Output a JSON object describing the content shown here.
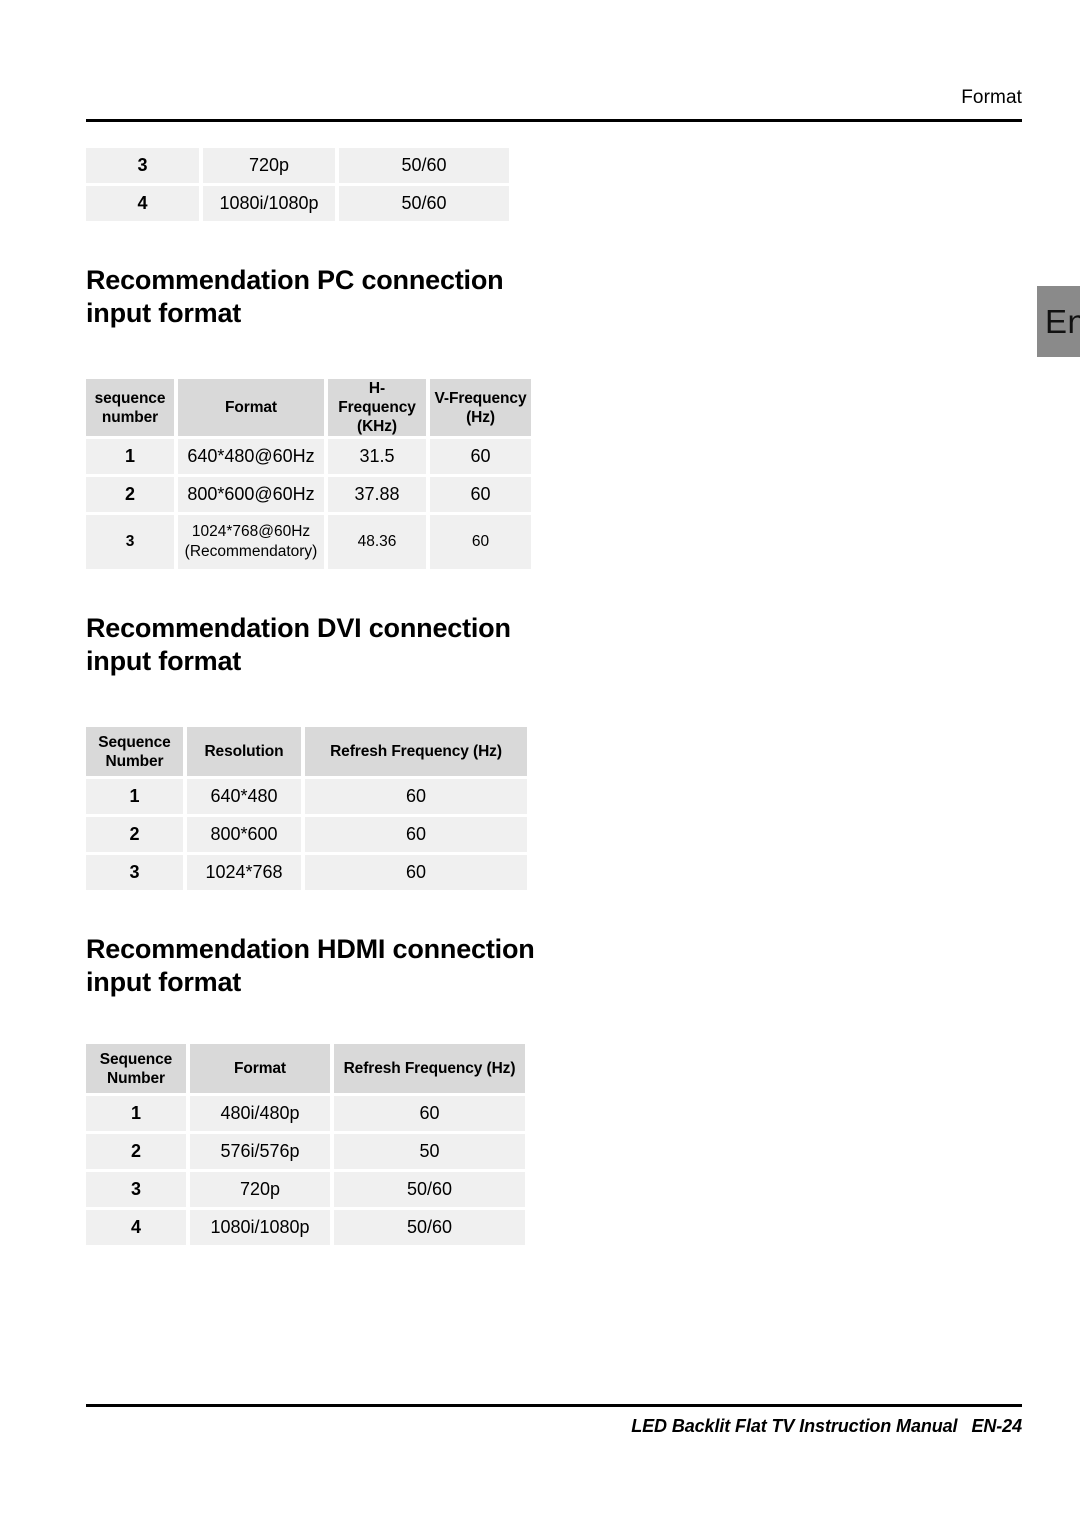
{
  "header": {
    "label": "Format"
  },
  "language_tab": {
    "label": "En"
  },
  "continued_table": {
    "rows": [
      {
        "sequence": "3",
        "format": "720p",
        "refresh": "50/60"
      },
      {
        "sequence": "4",
        "format": "1080i/1080p",
        "refresh": "50/60"
      }
    ]
  },
  "sections": [
    {
      "title": "Recommendation PC connection input format",
      "table": {
        "headers": [
          "sequence number",
          "Format",
          "H-Frequency (KHz)",
          "V-Frequency (Hz)"
        ],
        "headers_lines": [
          [
            "sequence",
            "number"
          ],
          [
            "Format"
          ],
          [
            "H-Frequency",
            "(KHz)"
          ],
          [
            "V-Frequency",
            "(Hz)"
          ]
        ],
        "rows": [
          {
            "sequence": "1",
            "format": "640*480@60Hz",
            "format_line2": "",
            "h_frequency": "31.5",
            "v_frequency": "60"
          },
          {
            "sequence": "2",
            "format": "800*600@60Hz",
            "format_line2": "",
            "h_frequency": "37.88",
            "v_frequency": "60"
          },
          {
            "sequence": "3",
            "format": "1024*768@60Hz",
            "format_line2": "(Recommendatory)",
            "h_frequency": "48.36",
            "v_frequency": "60"
          }
        ]
      }
    },
    {
      "title": "Recommendation DVI connection input format",
      "table": {
        "headers": [
          "Sequence Number",
          "Resolution",
          "Refresh Frequency (Hz)"
        ],
        "headers_lines": [
          [
            "Sequence",
            "Number"
          ],
          [
            "Resolution"
          ],
          [
            "Refresh Frequency (Hz)"
          ]
        ],
        "rows": [
          {
            "sequence": "1",
            "resolution": "640*480",
            "refresh": "60"
          },
          {
            "sequence": "2",
            "resolution": "800*600",
            "refresh": "60"
          },
          {
            "sequence": "3",
            "resolution": "1024*768",
            "refresh": "60"
          }
        ]
      }
    },
    {
      "title": "Recommendation HDMI connection input format",
      "table": {
        "headers": [
          "Sequence Number",
          "Format",
          "Refresh Frequency (Hz)"
        ],
        "headers_lines": [
          [
            "Sequence",
            "Number"
          ],
          [
            "Format"
          ],
          [
            "Refresh Frequency (Hz)"
          ]
        ],
        "rows": [
          {
            "sequence": "1",
            "format": "480i/480p",
            "refresh": "60"
          },
          {
            "sequence": "2",
            "format": "576i/576p",
            "refresh": "50"
          },
          {
            "sequence": "3",
            "format": "720p",
            "refresh": "50/60"
          },
          {
            "sequence": "4",
            "format": "1080i/1080p",
            "refresh": "50/60"
          }
        ]
      }
    }
  ],
  "footer": {
    "manual_title": "LED Backlit Flat TV Instruction Manual",
    "page_number": "EN-24"
  },
  "colors": {
    "table_header_bg": "#d9d9d9",
    "table_cell_bg": "#f0f0f0",
    "rule": "#000000",
    "lang_tab_bg": "#8a8a8a",
    "page_bg": "#ffffff"
  }
}
